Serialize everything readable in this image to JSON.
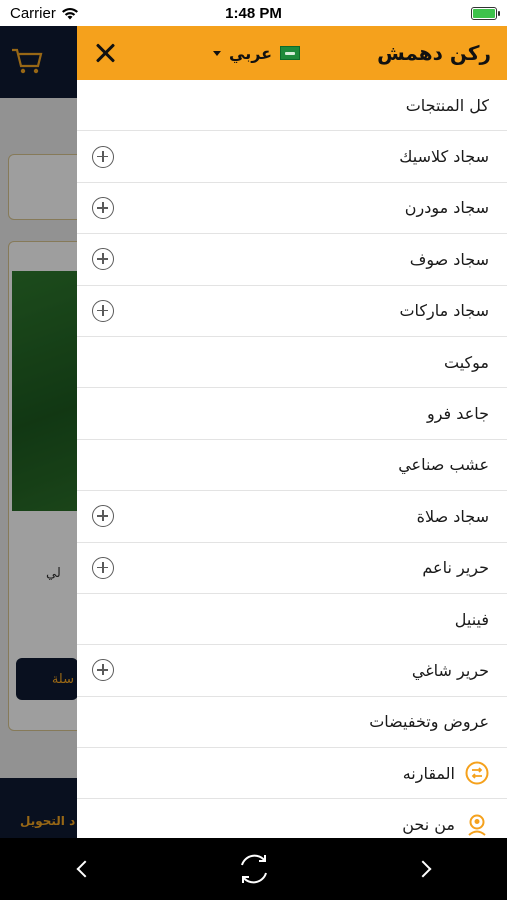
{
  "status_bar": {
    "carrier": "Carrier",
    "time": "1:48 PM"
  },
  "background": {
    "bottom_label": "د التحويل",
    "button_label": "سلة",
    "text_fragment": "لي"
  },
  "drawer": {
    "store_title": "ركن دهمش",
    "language_label": "عربي",
    "menu": [
      {
        "label": "كل المنتجات",
        "expandable": false
      },
      {
        "label": "سجاد كلاسيك",
        "expandable": true
      },
      {
        "label": "سجاد مودرن",
        "expandable": true
      },
      {
        "label": "سجاد صوف",
        "expandable": true
      },
      {
        "label": "سجاد ماركات",
        "expandable": true
      },
      {
        "label": "موكيت",
        "expandable": false
      },
      {
        "label": "جاعد فرو",
        "expandable": false
      },
      {
        "label": "عشب صناعي",
        "expandable": false
      },
      {
        "label": "سجاد صلاة",
        "expandable": true
      },
      {
        "label": "حرير ناعم",
        "expandable": true
      },
      {
        "label": "فينيل",
        "expandable": false
      },
      {
        "label": "حرير شاغي",
        "expandable": true
      },
      {
        "label": "عروض وتخفيضات",
        "expandable": false
      },
      {
        "label": "المقارنه",
        "icon": "compare-icon"
      },
      {
        "label": "من نحن",
        "icon": "about-us-icon"
      }
    ]
  },
  "colors": {
    "accent": "#f5a11c",
    "navy": "#0f1b33"
  }
}
